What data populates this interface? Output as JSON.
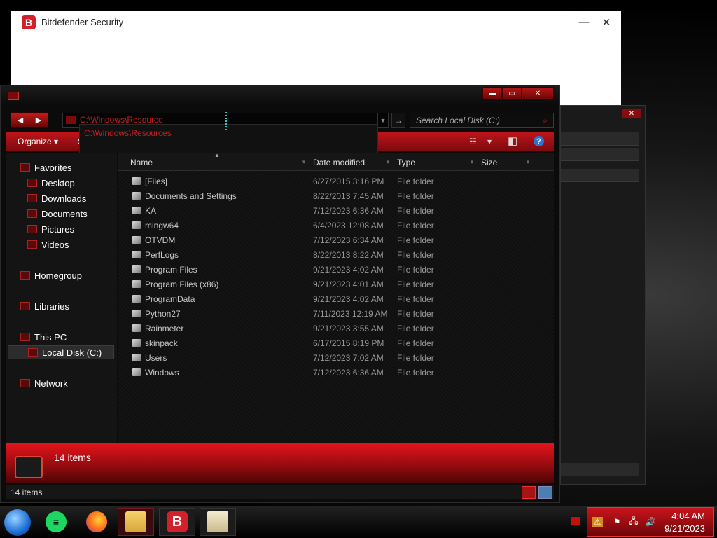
{
  "bitdefender": {
    "title": "Bitdefender Security",
    "logo_letter": "B",
    "minimize_glyph": "—",
    "close_glyph": "✕"
  },
  "explorer": {
    "caption": {
      "minimize": "▬",
      "maximize": "▭",
      "close": "✕"
    },
    "nav": {
      "back": "◀",
      "forward": "▶"
    },
    "address": {
      "value": "C:\\Windows\\Resource",
      "dropdown_glyph": "▼",
      "go_glyph": "→"
    },
    "autocomplete": {
      "item": "C:\\Windows\\Resources"
    },
    "search": {
      "placeholder": "Search Local Disk (C:)",
      "icon": "search-icon",
      "glyph": "⌕"
    },
    "toolbar": {
      "organize": "Organize ▾",
      "share_fragment": "S",
      "view_glyph": "☷",
      "view_dropdown": "▾",
      "pane_glyph": "◧",
      "help_glyph": "?"
    },
    "navpane": {
      "favorites": "Favorites",
      "desktop": "Desktop",
      "downloads": "Downloads",
      "documents": "Documents",
      "pictures": "Pictures",
      "videos": "Videos",
      "homegroup": "Homegroup",
      "libraries": "Libraries",
      "this_pc": "This PC",
      "local_disk": "Local Disk (C:)",
      "network": "Network"
    },
    "columns": {
      "name": "Name",
      "date": "Date modified",
      "type": "Type",
      "size": "Size"
    },
    "files": [
      {
        "name": "[Files]",
        "date": "6/27/2015 3:16 PM",
        "type": "File folder"
      },
      {
        "name": "Documents and Settings",
        "date": "8/22/2013 7:45 AM",
        "type": "File folder"
      },
      {
        "name": "KA",
        "date": "7/12/2023 6:36 AM",
        "type": "File folder"
      },
      {
        "name": "mingw64",
        "date": "6/4/2023 12:08 AM",
        "type": "File folder"
      },
      {
        "name": "OTVDM",
        "date": "7/12/2023 6:34 AM",
        "type": "File folder"
      },
      {
        "name": "PerfLogs",
        "date": "8/22/2013 8:22 AM",
        "type": "File folder"
      },
      {
        "name": "Program Files",
        "date": "9/21/2023 4:02 AM",
        "type": "File folder"
      },
      {
        "name": "Program Files (x86)",
        "date": "9/21/2023 4:01 AM",
        "type": "File folder"
      },
      {
        "name": "ProgramData",
        "date": "9/21/2023 4:02 AM",
        "type": "File folder"
      },
      {
        "name": "Python27",
        "date": "7/11/2023 12:19 AM",
        "type": "File folder"
      },
      {
        "name": "Rainmeter",
        "date": "9/21/2023 3:55 AM",
        "type": "File folder"
      },
      {
        "name": "skinpack",
        "date": "6/17/2015 8:19 PM",
        "type": "File folder"
      },
      {
        "name": "Users",
        "date": "7/12/2023 7:02 AM",
        "type": "File folder"
      },
      {
        "name": "Windows",
        "date": "7/12/2023 6:36 AM",
        "type": "File folder"
      }
    ],
    "details_text": "14 items",
    "status_text": "14 items"
  },
  "taskbar": {
    "apps": [
      "spotify",
      "firefox",
      "file-explorer",
      "bitdefender",
      "notepad"
    ],
    "bitdefender_letter": "B",
    "tray_icons": [
      "⚠",
      "⚑",
      "🖧",
      "🔊"
    ],
    "time": "4:04 AM",
    "date": "9/21/2023"
  },
  "colors": {
    "accent": "#c81e1e",
    "dark": "#0b0b0b"
  }
}
